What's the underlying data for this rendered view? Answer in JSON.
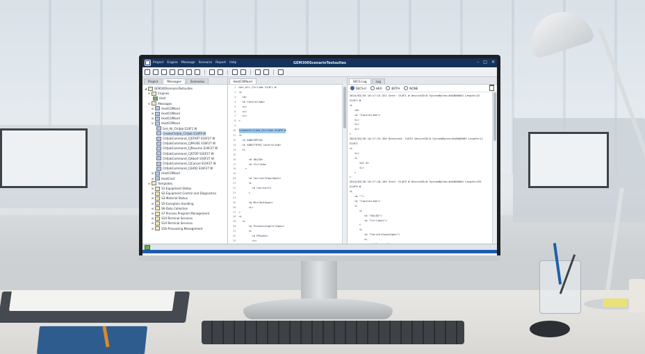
{
  "app": {
    "title": "GEM300ScenarioTestsuites",
    "menu": [
      "Project",
      "Engine",
      "Message",
      "Scenario",
      "Report",
      "Help"
    ],
    "window_controls": [
      "–",
      "□",
      "✕"
    ]
  },
  "left_panel": {
    "tabs": [
      "Project",
      "Messages",
      "Scenarios"
    ],
    "active_tab": "Messages",
    "tree": [
      {
        "label": "GEM300ScenarioTestsuites",
        "depth": 0,
        "icon": "folder-icon",
        "toggle": "◢"
      },
      {
        "label": "Engines",
        "depth": 1,
        "icon": "folder-icon",
        "toggle": "⊟"
      },
      {
        "label": "Host",
        "depth": 2,
        "icon": "engine-icon",
        "toggle": ""
      },
      {
        "label": "Messages",
        "depth": 1,
        "icon": "folder-icon",
        "toggle": "⊟"
      },
      {
        "label": "HostCOMand",
        "depth": 2,
        "icon": "message-icon",
        "toggle": "⊞"
      },
      {
        "label": "HostCOMand",
        "depth": 2,
        "icon": "message-icon",
        "toggle": "⊞"
      },
      {
        "label": "HostCOMand",
        "depth": 2,
        "icon": "message-icon",
        "toggle": "⊞"
      },
      {
        "label": "HostCOMand",
        "depth": 2,
        "icon": "message-icon",
        "toggle": "⊟"
      },
      {
        "label": "Get_All_CtrlJob S14F1 W",
        "depth": 3,
        "icon": "message-icon",
        "toggle": ""
      },
      {
        "label": "CreateCtrlJob_CtrlJob S14F9 W",
        "depth": 3,
        "icon": "message-icon",
        "toggle": "",
        "selected": true
      },
      {
        "label": "CtrlJobCommand_CJSTART S16F27 W",
        "depth": 3,
        "icon": "message-icon",
        "toggle": ""
      },
      {
        "label": "CtrlJobCommand_CJPAUSE S16F27 W",
        "depth": 3,
        "icon": "message-icon",
        "toggle": ""
      },
      {
        "label": "CtrlJobCommand_CJResume S16F27 W",
        "depth": 3,
        "icon": "message-icon",
        "toggle": ""
      },
      {
        "label": "CtrlJobCommand_CJSTOP S16F27 W",
        "depth": 3,
        "icon": "message-icon",
        "toggle": ""
      },
      {
        "label": "CtrlJobCommand_CJAbort S16F27 W",
        "depth": 3,
        "icon": "message-icon",
        "toggle": ""
      },
      {
        "label": "CtrlJobCommand_CJCancel S16F27 W",
        "depth": 3,
        "icon": "message-icon",
        "toggle": ""
      },
      {
        "label": "CtrlJobCommand_CJHOQ S16F27 W",
        "depth": 3,
        "icon": "message-icon",
        "toggle": ""
      },
      {
        "label": "HostCOMand",
        "depth": 2,
        "icon": "message-icon",
        "toggle": "⊞"
      },
      {
        "label": "HostCmd",
        "depth": 2,
        "icon": "message-icon",
        "toggle": "⊞"
      },
      {
        "label": "Templates",
        "depth": 1,
        "icon": "folder-icon",
        "toggle": "⊟"
      },
      {
        "label": "S1-Equipment Status",
        "depth": 2,
        "icon": "folder-icon",
        "toggle": "⊞"
      },
      {
        "label": "S2-Equipment Control and Diagnostics",
        "depth": 2,
        "icon": "folder-icon",
        "toggle": "⊞"
      },
      {
        "label": "S3-Material Status",
        "depth": 2,
        "icon": "folder-icon",
        "toggle": "⊞"
      },
      {
        "label": "S5-Exception Handling",
        "depth": 2,
        "icon": "folder-icon",
        "toggle": "⊞"
      },
      {
        "label": "S6-Data Collection",
        "depth": 2,
        "icon": "folder-icon",
        "toggle": "⊞"
      },
      {
        "label": "S7-Process Program Management",
        "depth": 2,
        "icon": "folder-icon",
        "toggle": "⊞"
      },
      {
        "label": "S10-Terminal Services",
        "depth": 2,
        "icon": "folder-icon",
        "toggle": "⊞"
      },
      {
        "label": "S14-Terminal Services",
        "depth": 2,
        "icon": "folder-icon",
        "toggle": "⊞"
      },
      {
        "label": "S16-Processing Management",
        "depth": 2,
        "icon": "folder-icon",
        "toggle": "⊞"
      }
    ]
  },
  "middle_panel": {
    "tab": "HostCOMand",
    "lines": [
      {
        "n": "1",
        "text": "Get_All_CtrlJob S14F1 W"
      },
      {
        "n": "2",
        "text": "<L"
      },
      {
        "n": "3",
        "text": "  <A>"
      },
      {
        "n": "4",
        "text": "  <A ControlJob>"
      },
      {
        "n": "5",
        "text": "  <L>"
      },
      {
        "n": "6",
        "text": "  <L>"
      },
      {
        "n": "7",
        "text": "  <L>"
      },
      {
        "n": "8",
        "text": ">"
      },
      {
        "n": "9",
        "text": ""
      },
      {
        "n": "10",
        "text": "CreateCtrlJob_CtrlJob S14F9 W",
        "hl": true
      },
      {
        "n": "11",
        "text": "<L"
      },
      {
        "n": "12",
        "text": "  <A $OBJSPEC$>"
      },
      {
        "n": "13",
        "text": "  <A $OBJTYPE$ ControlJob>"
      },
      {
        "n": "14",
        "text": "  <L"
      },
      {
        "n": "15",
        "text": ""
      },
      {
        "n": "16",
        "text": "      <A ObjID>"
      },
      {
        "n": "17",
        "text": "      <A CtrlJob>"
      },
      {
        "n": "18",
        "text": "    >"
      },
      {
        "n": "19",
        "text": ""
      },
      {
        "n": "20",
        "text": "      <A CarrierInputSpec>"
      },
      {
        "n": "21",
        "text": "      <L"
      },
      {
        "n": "22",
        "text": "        <A Carrier1>"
      },
      {
        "n": "23",
        "text": "      >"
      },
      {
        "n": "24",
        "text": ""
      },
      {
        "n": "25",
        "text": "      <A MtrlOutSpec>"
      },
      {
        "n": "26",
        "text": "      <L>"
      },
      {
        "n": "27",
        "text": ">"
      },
      {
        "n": "28",
        "text": "<L"
      },
      {
        "n": "29",
        "text": "  <L"
      },
      {
        "n": "30",
        "text": "      <A ProcessingCtrlSpec>"
      },
      {
        "n": "31",
        "text": "      <L"
      },
      {
        "n": "32",
        "text": "        <A PRJob1>"
      },
      {
        "n": "33",
        "text": "        <L>"
      },
      {
        "n": "34",
        "text": "        <L>"
      },
      {
        "n": "35",
        "text": "      >"
      },
      {
        "n": "36",
        "text": "    >"
      },
      {
        "n": "37",
        "text": "  >"
      },
      {
        "n": "38",
        "text": ">"
      }
    ]
  },
  "right_panel": {
    "tabs": [
      "SECS Log",
      "Log"
    ],
    "active_tab": "SECS Log",
    "radios": [
      {
        "label": "SECS-II",
        "checked": true
      },
      {
        "label": "HEX",
        "checked": false
      },
      {
        "label": "BOTH",
        "checked": false
      },
      {
        "label": "NONE",
        "checked": false
      }
    ],
    "log_lines": [
      "2024/03/20 10:17:15.321 Sent: S14F1 W DeviceID=0 SystemBytes=0x0000003 Length=22",
      "S14F1 W",
      "<L",
      "   <A>",
      "   <A \"ControlJob\">",
      "   <L>",
      "   <L>",
      "   <L>",
      ">",
      "",
      "2024/03/20 10:17:15.326 Received: S14F2 DeviceID=0 SystemBytes=0x0000003 Length=11",
      "S14F2",
      "<L",
      "   <L>",
      "   <L",
      "      <U1 0>",
      "      <L>",
      "   >",
      ">",
      "",
      "2024/03/20 10:17:18.103 Sent: S14F9 W DeviceID=0 SystemBytes=0x0000004 Length=155",
      "S14F9 W",
      "<L",
      "   <A \"\">",
      "   <A \"ControlJob\">",
      "   <L",
      "      <L",
      "         <A \"ObjID\">",
      "         <A \"CtrlJob1\">",
      "      >",
      "      <L",
      "         <A \"CarrierInputSpec\">",
      "         <L",
      "            <A \"Carrier1\">",
      "         >",
      "      >",
      "      <L",
      "         <A \"MtrlOutSpec\">"
    ]
  },
  "colors": {
    "titlebar": "#16325c",
    "selection": "#9cc7ee",
    "status_accent": "#1d5bb3"
  }
}
